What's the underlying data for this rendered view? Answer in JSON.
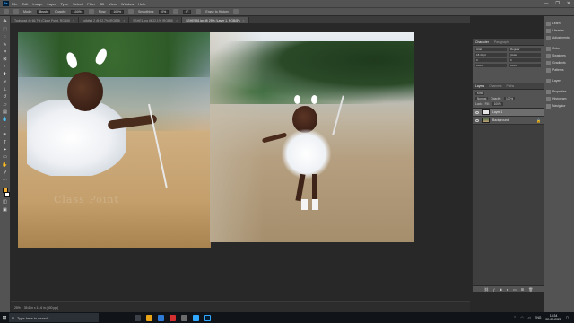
{
  "app": {
    "logo": "Ps"
  },
  "menu": [
    "File",
    "Edit",
    "Image",
    "Layer",
    "Type",
    "Select",
    "Filter",
    "3D",
    "View",
    "Window",
    "Help"
  ],
  "window_controls": [
    "—",
    "❐",
    "✕"
  ],
  "options_bar": {
    "mode_label": "Mode:",
    "mode_value": "Brush",
    "opacity_label": "Opacity:",
    "opacity_value": "100%",
    "flow_label": "Flow:",
    "flow_value": "100%",
    "smoothing_label": "Smoothing:",
    "smoothing_value": "0%",
    "angle_value": "0°",
    "erase_history_label": "Erase to History"
  },
  "tabs": [
    {
      "label": "Tools.psd @ 66.7% (Clone Point, RGB/8)",
      "active": false
    },
    {
      "label": "bdfdfsd 2 @ 22.7% (RGB/8)",
      "active": false
    },
    {
      "label": "SSHE1.jpg @ 22.1% (RGB/8)",
      "active": false
    },
    {
      "label": "SSHE998.jpg @ 25% (Layer 1, RGB/8*)",
      "active": true
    }
  ],
  "canvas": {
    "watermark": "Class Point"
  },
  "panel_strip": {
    "group1": [
      "Learn",
      "Libraries",
      "Adjustments"
    ],
    "group2": [
      "Color",
      "Swatches",
      "Gradients",
      "Patterns"
    ],
    "group3": [
      "Layers"
    ],
    "group4": [
      "Properties",
      "Histogram",
      "Navigator"
    ]
  },
  "character_panel": {
    "tabs": [
      "Character",
      "Paragraph"
    ],
    "font_family": "Arial",
    "font_style": "Regular",
    "font_size": "18.43 pt",
    "leading": "(Auto)",
    "kerning": "0",
    "tracking": "0",
    "vertical_scale": "100%",
    "horizontal_scale": "100%"
  },
  "layers_panel": {
    "tabs": [
      "Layers",
      "Channels",
      "Paths"
    ],
    "filter_label": "Kind",
    "blend_mode": "Normal",
    "opacity_label": "Opacity:",
    "opacity_value": "100%",
    "lock_label": "Lock:",
    "fill_label": "Fill:",
    "fill_value": "100%",
    "layers": [
      {
        "name": "Layer 1",
        "selected": true
      },
      {
        "name": "Background",
        "selected": false
      }
    ],
    "footer_icons": [
      "link-icon",
      "fx-icon",
      "mask-icon",
      "adjustment-icon",
      "folder-icon",
      "new-layer-icon",
      "trash-icon"
    ]
  },
  "status": {
    "zoom": "25%",
    "doc_info": "35.6 in x 14.6 in (300 ppi)"
  },
  "taskbar": {
    "search_placeholder": "Type here to search",
    "lang": "ENG",
    "time": "13:34",
    "date": "22-02-2021"
  }
}
